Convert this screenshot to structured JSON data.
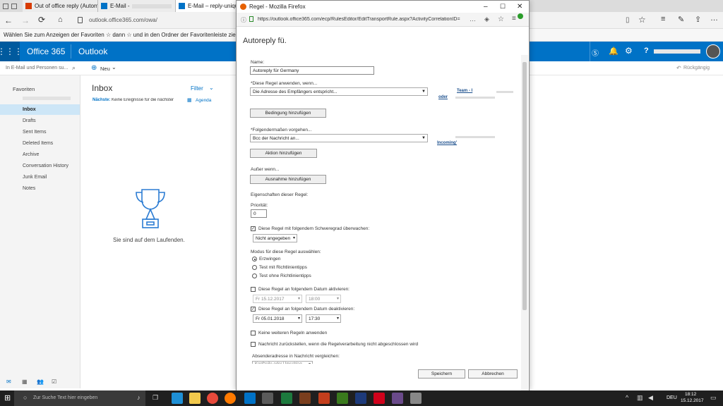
{
  "browser": {
    "tabs": [
      {
        "label": "Out of office reply (Automa"
      },
      {
        "label": "E-Mail -"
      },
      {
        "label": "E-Mail – reply-unique-"
      }
    ],
    "url": "outlook.office365.com/owa/",
    "favorites_hint": "Wählen Sie zum Anzeigen der Favoriten  ☆  dann ☆ und in den Ordner der Favoritenleiste ziehen"
  },
  "owa": {
    "brand": "Office 365",
    "app": "Outlook",
    "search_placeholder": "In E-Mail und Personen su...",
    "new_label": "Neu",
    "undo_label": "Rückgängig",
    "favorites_label": "Favoriten",
    "inbox_title": "Inbox",
    "filter_label": "Filter",
    "next_label": "Nächste:",
    "next_text": "Keine Ereignisse für die nächsten zw",
    "agenda_label": "Agenda",
    "empty_text": "Sie sind auf dem Laufenden.",
    "folders": [
      {
        "label": "Inbox"
      },
      {
        "label": "Drafts"
      },
      {
        "label": "Sent Items"
      },
      {
        "label": "Deleted Items"
      },
      {
        "label": "Archive"
      },
      {
        "label": "Conversation History"
      },
      {
        "label": "Junk Email"
      },
      {
        "label": "Notes"
      }
    ]
  },
  "dialog": {
    "window_title": "Regel - Mozilla Firefox",
    "url": "https://outlook.office365.com/ecp/RulesEditor/EditTransportRule.aspx?ActivityCorrelationID=",
    "heading": "Autoreply fü.",
    "name_label": "Name:",
    "name_value": "Autoreply für            Germany",
    "apply_label": "*Diese Regel anwenden, wenn...",
    "apply_value": "Die Adresse des Empfängers entspricht...",
    "or_label": "oder",
    "team_link": "Team - I",
    "add_condition": "Bedingung hinzufügen",
    "do_label": "*Folgendermaßen vorgehen...",
    "do_value": "Bcc der Nachricht an...",
    "incoming_link": "Incoming'",
    "add_action": "Aktion hinzufügen",
    "except_label": "Außer wenn...",
    "add_exception": "Ausnahme hinzufügen",
    "props_label": "Eigenschaften dieser Regel:",
    "priority_label": "Priorität:",
    "priority_value": "0",
    "severity_check_label": "Diese Regel mit folgendem Schweregrad überwachen:",
    "severity_value": "Nicht angegeben",
    "mode_label": "Modus für diese Regel auswählen:",
    "mode_options": [
      "Erzwingen",
      "Test mit Richtlinientipps",
      "Test ohne Richtlinientipps"
    ],
    "activate_label": "Diese Regel an folgendem Datum aktivieren:",
    "activate_date": "Fr 15.12.2017",
    "activate_time": "18:00",
    "deactivate_label": "Diese Regel an folgendem Datum deaktivieren:",
    "deactivate_date": "Fr 05.01.2018",
    "deactivate_time": "17:30",
    "stop_label": "Keine weiteren Regeln anwenden",
    "defer_label": "Nachricht zurückstellen, wenn die Regelverarbeitung nicht abgeschlossen wird",
    "sender_label": "Absenderadresse in Nachricht vergleichen:",
    "sender_value": "Kopfzeile oder Umschlag",
    "save": "Speichern",
    "cancel": "Abbrechen"
  },
  "taskbar": {
    "search_placeholder": "Zur Suche Text hier eingeben",
    "lang": "DEU",
    "time": "18:12",
    "date": "15.12.2017"
  },
  "colors": {
    "owa_blue": "#0072c6",
    "link_blue": "#1a4e8c",
    "taskbar": "#1f1f1f"
  }
}
